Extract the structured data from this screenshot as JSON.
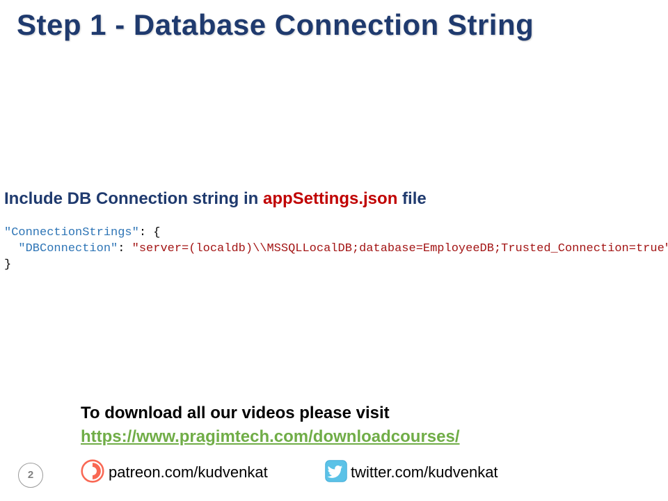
{
  "title": "Step 1 - Database Connection String",
  "instruction": {
    "prefix": "Include DB Connection string in ",
    "highlight": "appSettings.json",
    "suffix": " file"
  },
  "code": {
    "key1": "\"ConnectionStrings\"",
    "colon1": ": ",
    "openBrace": "{",
    "indent": "  ",
    "key2": "\"DBConnection\"",
    "colon2": ": ",
    "value": "\"server=(localdb)\\\\MSSQLLocalDB;database=EmployeeDB;Trusted_Connection=true\"",
    "closeBrace": "}"
  },
  "download": {
    "text": "To download all our videos please visit",
    "link": "https://www.pragimtech.com/downloadcourses/"
  },
  "pageNumber": "2",
  "social": {
    "patreon": "patreon.com/kudvenkat",
    "twitter": "twitter.com/kudvenkat"
  }
}
